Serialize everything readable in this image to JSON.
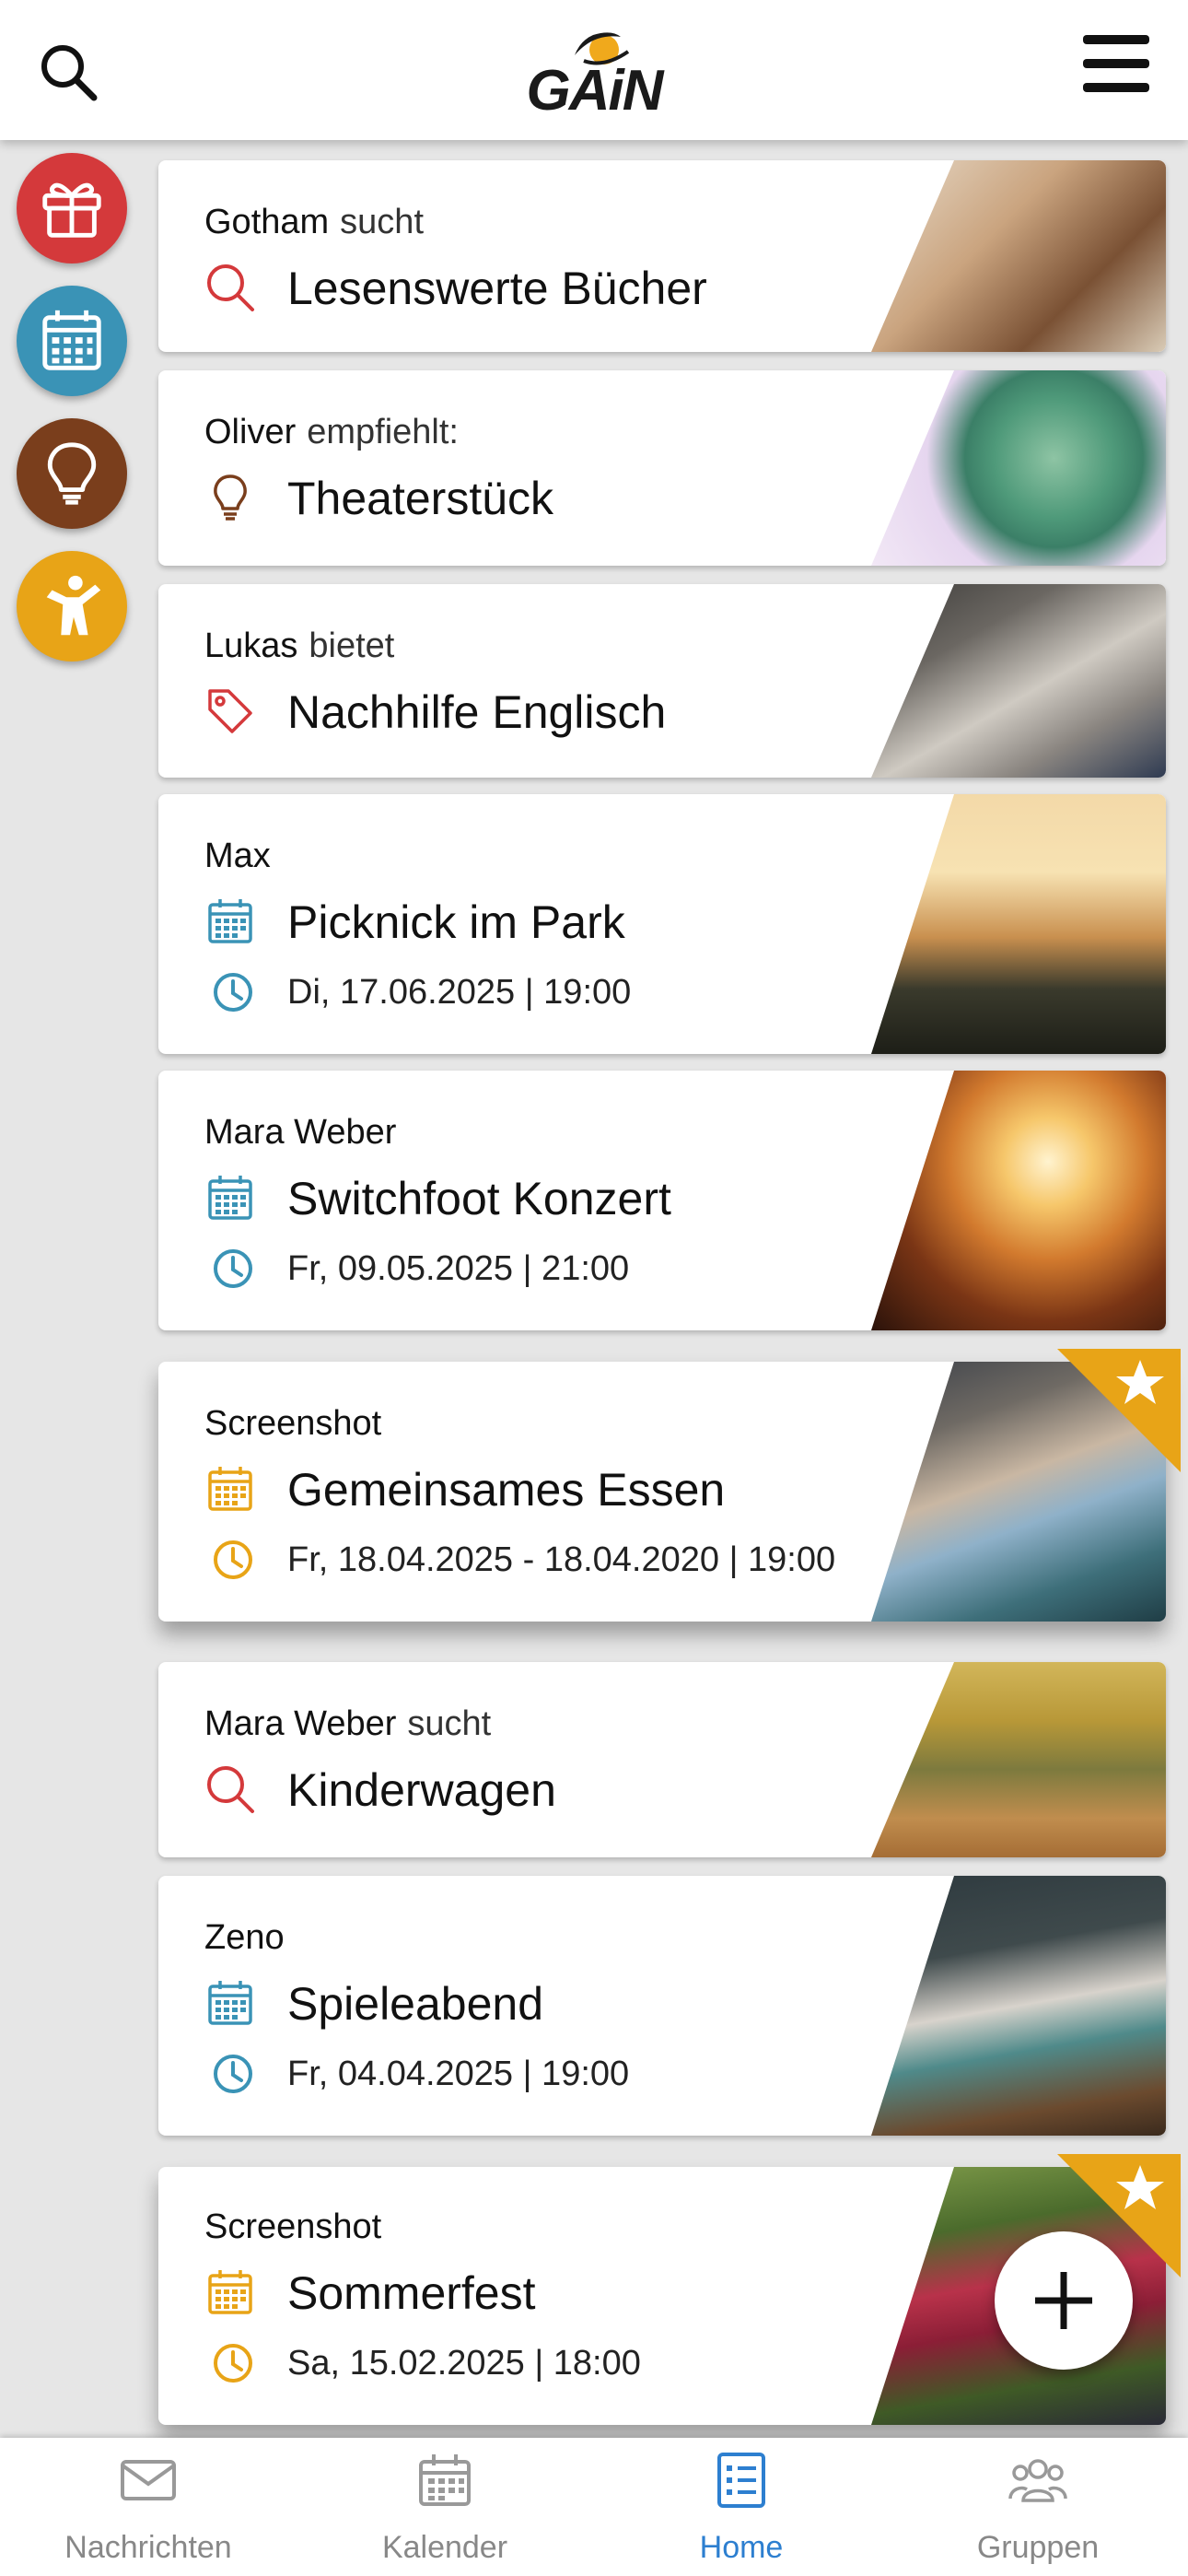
{
  "header": {
    "logo_text": "GAiN"
  },
  "side_buttons": [
    {
      "name": "gift",
      "color": "#d4393b"
    },
    {
      "name": "calendar",
      "color": "#3a93b6"
    },
    {
      "name": "lightbulb",
      "color": "#7a3e1c"
    },
    {
      "name": "person",
      "color": "#e8a417"
    }
  ],
  "cards": [
    {
      "author": "Gotham",
      "verb": "sucht",
      "icon": "search-icon",
      "title": "Lesenswerte Bücher"
    },
    {
      "author": "Oliver",
      "verb": "empfiehlt:",
      "icon": "lightbulb-icon",
      "title": "Theaterstück"
    },
    {
      "author": "Lukas",
      "verb": "bietet",
      "icon": "tag-icon",
      "title": "Nachhilfe Englisch"
    },
    {
      "author": "Max",
      "icon": "calendar-icon",
      "title": "Picknick im Park",
      "date": "Di, 17.06.2025 | 19:00"
    },
    {
      "author": "Mara Weber",
      "icon": "calendar-icon",
      "title": "Switchfoot Konzert",
      "date": "Fr, 09.05.2025 | 21:00"
    },
    {
      "author": "Screenshot",
      "icon": "calendar-icon",
      "title": "Gemeinsames Essen",
      "date": "Fr, 18.04.2025 - 18.04.2020 | 19:00",
      "featured": true
    },
    {
      "author": "Mara Weber",
      "verb": "sucht",
      "icon": "search-icon",
      "title": "Kinderwagen"
    },
    {
      "author": "Zeno",
      "icon": "calendar-icon",
      "title": "Spieleabend",
      "date": "Fr, 04.04.2025 | 19:00"
    },
    {
      "author": "Screenshot",
      "icon": "calendar-icon",
      "title": "Sommerfest",
      "date": "Sa, 15.02.2025 | 18:00",
      "featured": true
    }
  ],
  "colors": {
    "search": "#d4393b",
    "lightbulb": "#7a3e1c",
    "event": "#3a93b6",
    "featured": "#e8a417",
    "active_nav": "#2d7fd0"
  },
  "bottom_nav": [
    {
      "label": "Nachrichten",
      "icon": "mail-icon"
    },
    {
      "label": "Kalender",
      "icon": "calendar-icon"
    },
    {
      "label": "Home",
      "icon": "list-icon",
      "active": true
    },
    {
      "label": "Gruppen",
      "icon": "group-icon"
    }
  ]
}
